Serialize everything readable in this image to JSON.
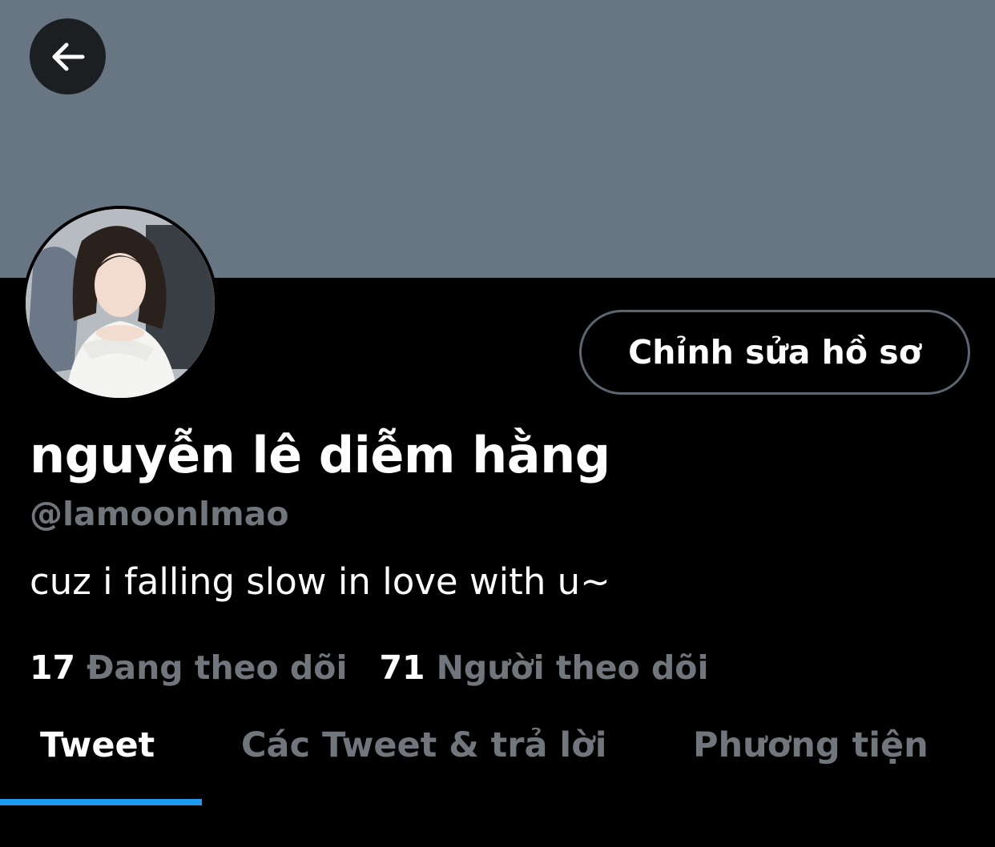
{
  "header": {
    "back_icon": "arrow-left-icon",
    "banner_color": "#687684"
  },
  "profile": {
    "avatar": "profile-photo",
    "edit_label": "Chỉnh sửa hồ sơ",
    "display_name": "nguyễn lê diễm hằng",
    "handle": "@lamoonlmao",
    "bio": "cuz i falling slow in love with u~"
  },
  "stats": {
    "following_count": "17",
    "following_label": "Đang theo dõi",
    "followers_count": "71",
    "followers_label": "Người theo dõi"
  },
  "tabs": [
    {
      "label": "Tweet",
      "active": true
    },
    {
      "label": "Các Tweet & trả lời",
      "active": false
    },
    {
      "label": "Phương tiện",
      "active": false
    }
  ],
  "colors": {
    "accent": "#1d9bf0",
    "muted_text": "#71767c",
    "background": "#000000"
  }
}
